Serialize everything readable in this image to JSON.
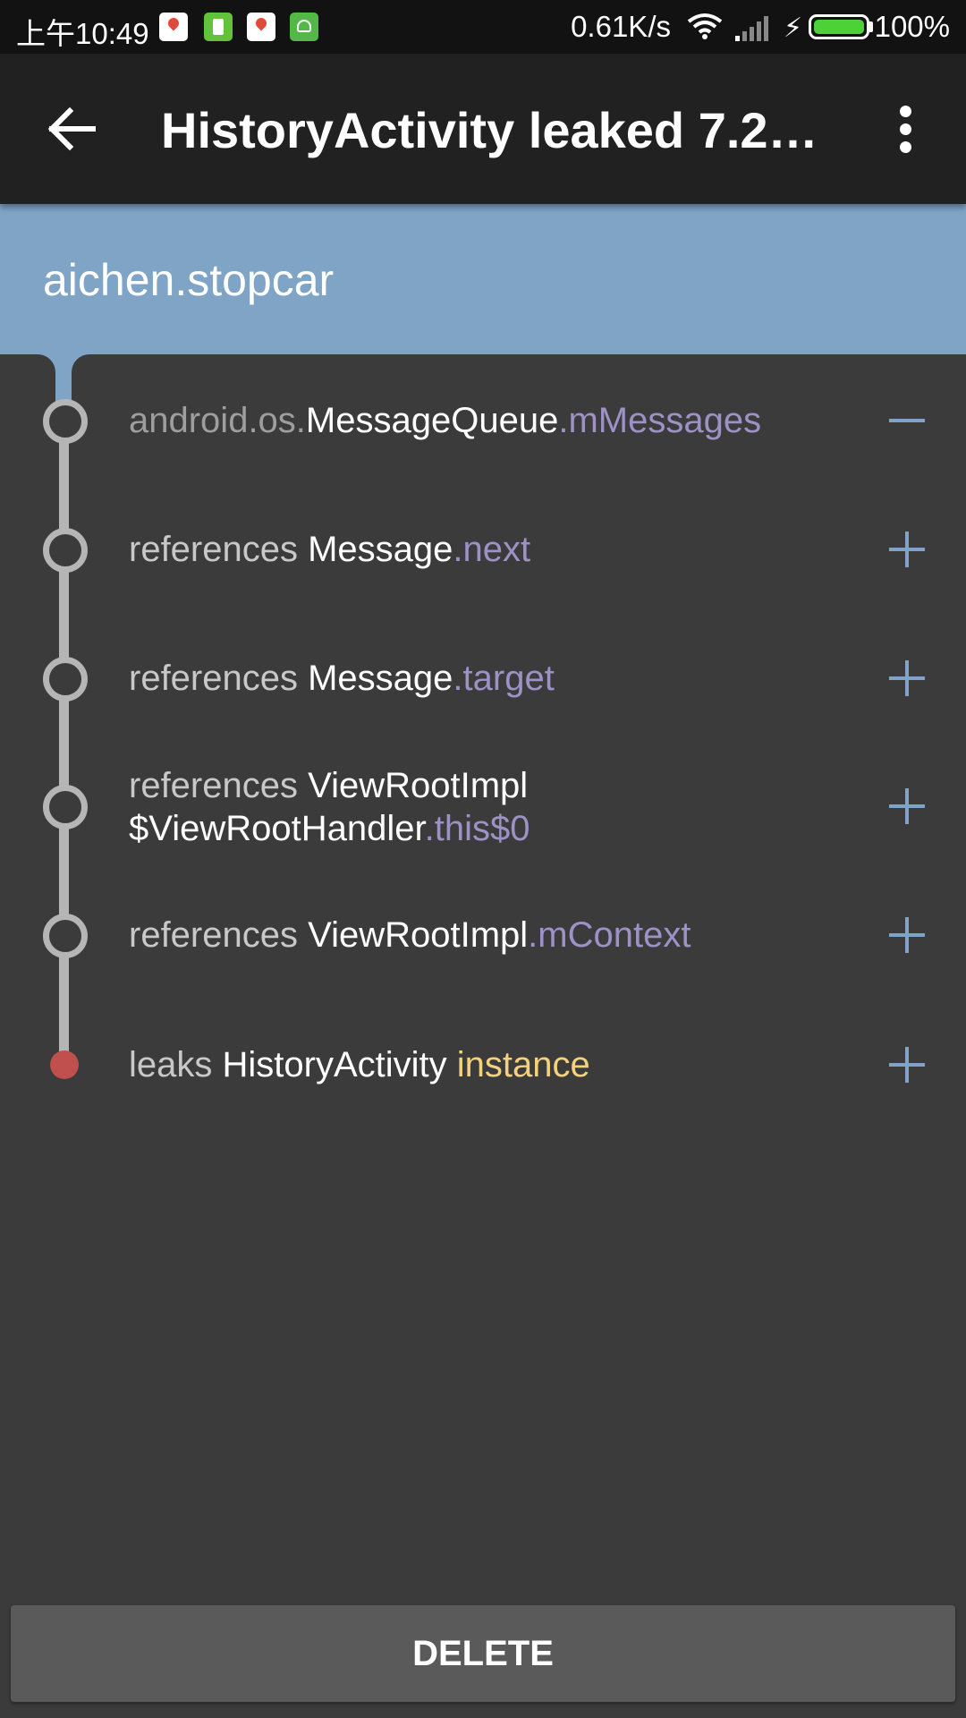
{
  "status_bar": {
    "time": "上午10:49",
    "net_speed": "0.61K/s",
    "battery_pct": "100%",
    "battery_color": "#4cd137",
    "icons": [
      "map-pin-icon",
      "battery-app-icon",
      "map-pin-icon",
      "android-icon",
      "wifi-icon",
      "signal-icon",
      "charging-bolt-icon",
      "battery-icon"
    ]
  },
  "app_bar": {
    "title": "HistoryActivity leaked 7.2…",
    "back_icon": "arrow-left-icon",
    "menu_icon": "more-vert-icon",
    "background": "#212121"
  },
  "package_header": {
    "name": "aichen.stopcar",
    "background": "#7fa4c6"
  },
  "leak_trace": [
    {
      "prefix": "android.os.",
      "class_name": "MessageQueue",
      "separator": ".",
      "field": "mMessages",
      "action": "collapse"
    },
    {
      "prefix": "references ",
      "class_name": "Message",
      "separator": ".",
      "field": "next",
      "action": "expand"
    },
    {
      "prefix": "references ",
      "class_name": "Message",
      "separator": ".",
      "field": "target",
      "action": "expand"
    },
    {
      "prefix": "references ",
      "class_name": "ViewRootImpl",
      "class_name_line2": "$ViewRootHandler",
      "separator": ".",
      "field": "this$0",
      "action": "expand"
    },
    {
      "prefix": "references ",
      "class_name": "ViewRootImpl",
      "separator": ".",
      "field": "mContext",
      "action": "expand"
    },
    {
      "prefix": "leaks ",
      "class_name": "HistoryActivity",
      "separator": " ",
      "field": "instance",
      "action": "expand"
    }
  ],
  "colors": {
    "field": "#9e91c6",
    "leak_instance": "#f4d17c",
    "leak_node": "#c0504d",
    "action_icon": "#7fa4c6"
  },
  "delete_button": {
    "label": "DELETE"
  }
}
